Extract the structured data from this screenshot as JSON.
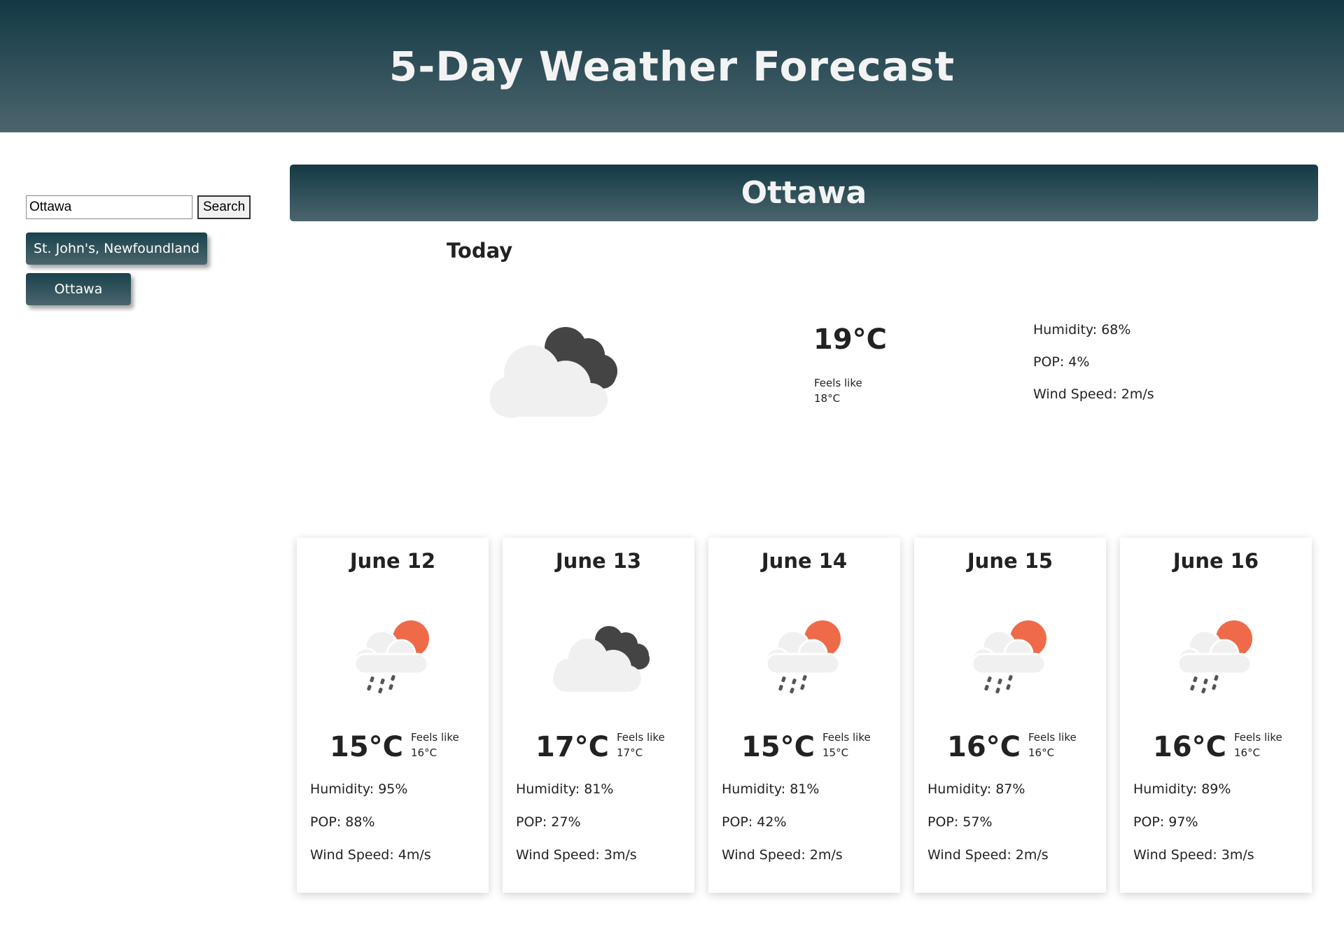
{
  "header": {
    "title": "5-Day Weather Forecast"
  },
  "search": {
    "value": "Ottawa",
    "button_label": "Search"
  },
  "saved_cities": [
    "St. John's, Newfoundland",
    "Ottawa"
  ],
  "city": "Ottawa",
  "today": {
    "label": "Today",
    "icon": "cloudy-icon",
    "temp": "19°C",
    "feels_like_label": "Feels like",
    "feels_like": "18°C",
    "humidity": "Humidity: 68%",
    "pop": "POP: 4%",
    "wind": "Wind Speed: 2m/s"
  },
  "forecast": [
    {
      "date": "June 12",
      "icon": "rain-sun-icon",
      "temp": "15°C",
      "feels_like_label": "Feels like",
      "feels_like": "16°C",
      "humidity": "Humidity: 95%",
      "pop": "POP: 88%",
      "wind": "Wind Speed: 4m/s"
    },
    {
      "date": "June 13",
      "icon": "cloudy-icon",
      "temp": "17°C",
      "feels_like_label": "Feels like",
      "feels_like": "17°C",
      "humidity": "Humidity: 81%",
      "pop": "POP: 27%",
      "wind": "Wind Speed: 3m/s"
    },
    {
      "date": "June 14",
      "icon": "rain-sun-icon",
      "temp": "15°C",
      "feels_like_label": "Feels like",
      "feels_like": "15°C",
      "humidity": "Humidity: 81%",
      "pop": "POP: 42%",
      "wind": "Wind Speed: 2m/s"
    },
    {
      "date": "June 15",
      "icon": "rain-sun-icon",
      "temp": "16°C",
      "feels_like_label": "Feels like",
      "feels_like": "16°C",
      "humidity": "Humidity: 87%",
      "pop": "POP: 57%",
      "wind": "Wind Speed: 2m/s"
    },
    {
      "date": "June 16",
      "icon": "rain-sun-icon",
      "temp": "16°C",
      "feels_like_label": "Feels like",
      "feels_like": "16°C",
      "humidity": "Humidity: 89%",
      "pop": "POP: 97%",
      "wind": "Wind Speed: 3m/s"
    }
  ],
  "colors": {
    "header_top": "#133944",
    "header_bottom": "#4b656d",
    "sun": "#ef6a48",
    "cloud_light": "#f0f0f0",
    "cloud_dark": "#444444"
  }
}
